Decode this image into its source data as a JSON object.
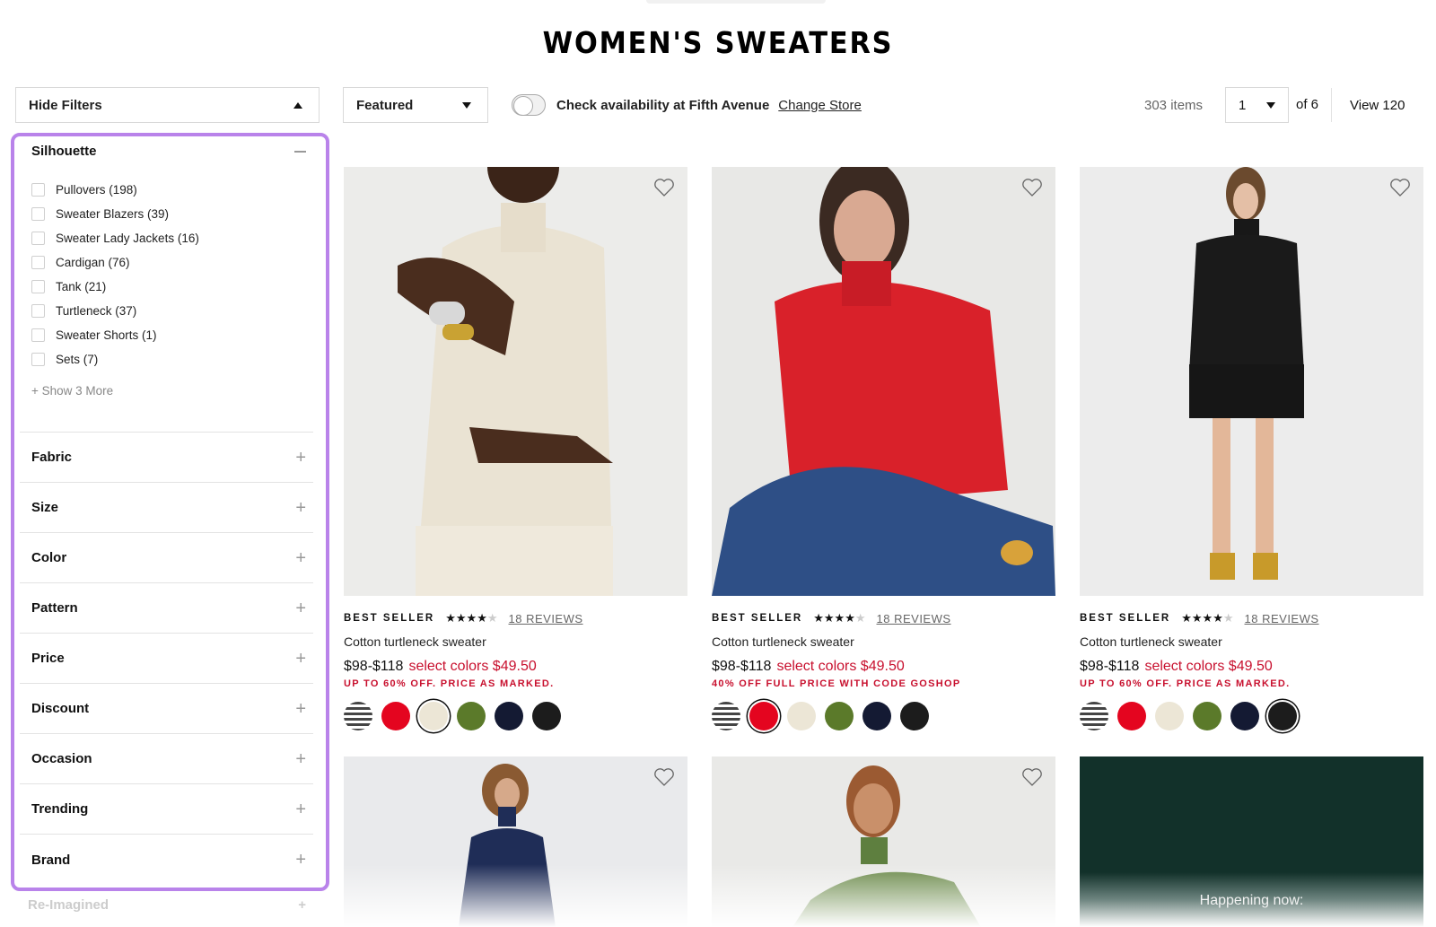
{
  "page": {
    "title": "WOMEN'S SWEATERS"
  },
  "toolbar": {
    "hide_filters_label": "Hide Filters",
    "sort_value": "Featured",
    "availability_label": "Check availability at Fifth Avenue",
    "change_store_label": "Change Store",
    "items_count": "303 items",
    "page_value": "1",
    "of_pages": "of 6",
    "view_label": "View 120"
  },
  "sidebar": {
    "silhouette": {
      "title": "Silhouette",
      "options": [
        {
          "label": "Pullovers (198)"
        },
        {
          "label": "Sweater Blazers (39)"
        },
        {
          "label": "Sweater Lady Jackets (16)"
        },
        {
          "label": "Cardigan (76)"
        },
        {
          "label": "Tank (21)"
        },
        {
          "label": "Turtleneck (37)"
        },
        {
          "label": "Sweater Shorts (1)"
        },
        {
          "label": "Sets (7)"
        }
      ],
      "show_more": "+ Show 3 More"
    },
    "sections": [
      {
        "label": "Fabric"
      },
      {
        "label": "Size"
      },
      {
        "label": "Color"
      },
      {
        "label": "Pattern"
      },
      {
        "label": "Price"
      },
      {
        "label": "Discount"
      },
      {
        "label": "Occasion"
      },
      {
        "label": "Trending"
      },
      {
        "label": "Brand"
      }
    ],
    "faded_section": "Re-Imagined",
    "highlight_color": "#b983ea"
  },
  "products": [
    {
      "badge": "BEST SELLER",
      "rating": 4.5,
      "stars": "★★★★",
      "half_star": "★",
      "reviews": "18 REVIEWS",
      "name": "Cotton turtleneck sweater",
      "price": "$98-$118",
      "sale": "select colors $49.50",
      "promo": "UP TO 60% OFF. PRICE AS MARKED.",
      "image_alt": "Model in cream turtleneck sweater",
      "selected_swatch": 2
    },
    {
      "badge": "BEST SELLER",
      "rating": 4.5,
      "stars": "★★★★",
      "half_star": "★",
      "reviews": "18 REVIEWS",
      "name": "Cotton turtleneck sweater",
      "price": "$98-$118",
      "sale": "select colors $49.50",
      "promo": "40% OFF FULL PRICE WITH CODE GOSHOP",
      "image_alt": "Model in red turtleneck sweater",
      "selected_swatch": 1
    },
    {
      "badge": "BEST SELLER",
      "rating": 4.5,
      "stars": "★★★★",
      "half_star": "★",
      "reviews": "18 REVIEWS",
      "name": "Cotton turtleneck sweater",
      "price": "$98-$118",
      "sale": "select colors $49.50",
      "promo": "UP TO 60% OFF. PRICE AS MARKED.",
      "image_alt": "Model in black turtleneck sweater",
      "selected_swatch": 5
    }
  ],
  "swatch_colors": [
    {
      "name": "stripe",
      "hex": "#444444"
    },
    {
      "name": "red",
      "hex": "#e4051f"
    },
    {
      "name": "cream",
      "hex": "#ece6d6"
    },
    {
      "name": "olive",
      "hex": "#5b7a2a"
    },
    {
      "name": "navy",
      "hex": "#141a33"
    },
    {
      "name": "black",
      "hex": "#1c1c1c"
    }
  ],
  "second_row": [
    {
      "image_alt": "Model in navy turtleneck sweater"
    },
    {
      "image_alt": "Model in green turtleneck sweater"
    }
  ],
  "promo_tile": {
    "text": "Happening now:",
    "bg": "#12312a"
  },
  "colors": {
    "sale_red": "#c8102e"
  }
}
